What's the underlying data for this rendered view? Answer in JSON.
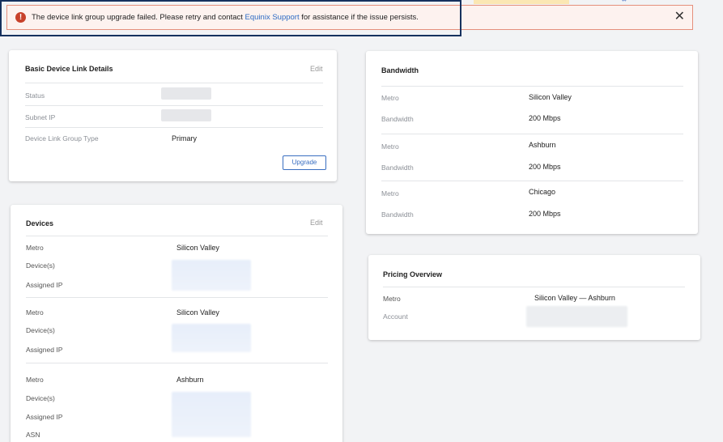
{
  "alert": {
    "message_before": "The device link group upgrade failed. Please retry and contact ",
    "link_text": "Equinix Support",
    "message_after": " for assistance if the issue persists.",
    "close_symbol": "✕"
  },
  "basic_details": {
    "title": "Basic Device Link Details",
    "edit_label": "Edit",
    "rows": [
      {
        "label": "Status",
        "value": ""
      },
      {
        "label": "Subnet IP",
        "value": ""
      },
      {
        "label": "Device Link Group Type",
        "value": "Primary"
      }
    ],
    "upgrade_label": "Upgrade"
  },
  "devices": {
    "title": "Devices",
    "edit_label": "Edit",
    "groups": [
      {
        "metro_label": "Metro",
        "metro": "Silicon Valley",
        "devices_label": "Device(s)",
        "ip_label": "Assigned IP"
      },
      {
        "metro_label": "Metro",
        "metro": "Silicon Valley",
        "devices_label": "Device(s)",
        "ip_label": "Assigned IP"
      },
      {
        "metro_label": "Metro",
        "metro": "Ashburn",
        "devices_label": "Device(s)",
        "ip_label": "Assigned IP",
        "asn_label": "ASN"
      }
    ]
  },
  "bandwidth": {
    "title": "Bandwidth",
    "rows": [
      {
        "metro_label": "Metro",
        "metro": "Silicon Valley",
        "bw_label": "Bandwidth",
        "bw": "200 Mbps"
      },
      {
        "metro_label": "Metro",
        "metro": "Ashburn",
        "bw_label": "Bandwidth",
        "bw": "200 Mbps"
      },
      {
        "metro_label": "Metro",
        "metro": "Chicago",
        "bw_label": "Bandwidth",
        "bw": "200 Mbps"
      }
    ]
  },
  "pricing": {
    "title": "Pricing Overview",
    "metro_label": "Metro",
    "metro": "Silicon Valley — Ashburn",
    "account_label": "Account"
  },
  "colors": {
    "alert_bg": "#fdf2ef",
    "alert_border": "#e58f7c",
    "error_icon": "#c8412a",
    "link": "#2d6bc4",
    "focus_outline": "#16315e"
  }
}
